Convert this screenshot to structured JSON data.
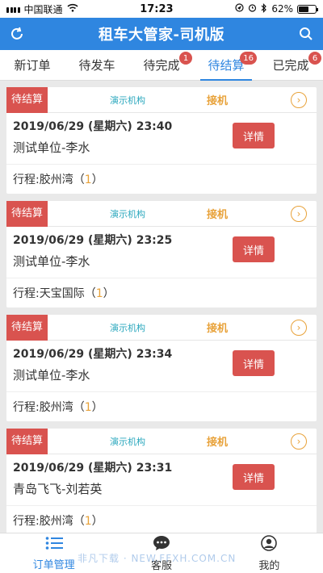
{
  "status_bar": {
    "carrier": "中国联通",
    "time": "17:23",
    "battery": "62%",
    "battery_level": 0.62
  },
  "header": {
    "title": "租车大管家-司机版",
    "left_icon": "refresh-icon",
    "right_icon": "search-icon"
  },
  "tabs": [
    {
      "label": "新订单",
      "badge": ""
    },
    {
      "label": "待发车",
      "badge": ""
    },
    {
      "label": "待完成",
      "badge": "1"
    },
    {
      "label": "待结算",
      "badge": "16",
      "active": true
    },
    {
      "label": "已完成",
      "badge": "6"
    }
  ],
  "orders": [
    {
      "status": "待结算",
      "org": "演示机构",
      "service": "接机",
      "datetime": "2019/06/29 (星期六) 23:40",
      "unit": "测试单位-李水",
      "route_label": "行程:胶州湾",
      "route_count": "1",
      "detail_label": "详情"
    },
    {
      "status": "待结算",
      "org": "演示机构",
      "service": "接机",
      "datetime": "2019/06/29 (星期六) 23:25",
      "unit": "测试单位-李水",
      "route_label": "行程:天宝国际",
      "route_count": "1",
      "detail_label": "详情"
    },
    {
      "status": "待结算",
      "org": "演示机构",
      "service": "接机",
      "datetime": "2019/06/29 (星期六) 23:34",
      "unit": "测试单位-李水",
      "route_label": "行程:胶州湾",
      "route_count": "1",
      "detail_label": "详情"
    },
    {
      "status": "待结算",
      "org": "演示机构",
      "service": "接机",
      "datetime": "2019/06/29 (星期六) 23:31",
      "unit": "青岛飞飞-刘若英",
      "route_label": "行程:胶州湾",
      "route_count": "1",
      "detail_label": "详情"
    }
  ],
  "bottom_nav": [
    {
      "label": "订单管理",
      "icon": "list-icon",
      "active": true
    },
    {
      "label": "客服",
      "icon": "chat-icon"
    },
    {
      "label": "我的",
      "icon": "user-icon"
    }
  ],
  "watermark": "非凡下载 · NEW.FFXH.COM.CN",
  "colors": {
    "primary": "#2f86e0",
    "danger": "#d9534f",
    "accent": "#e8a23a",
    "org": "#2aa7bd"
  }
}
